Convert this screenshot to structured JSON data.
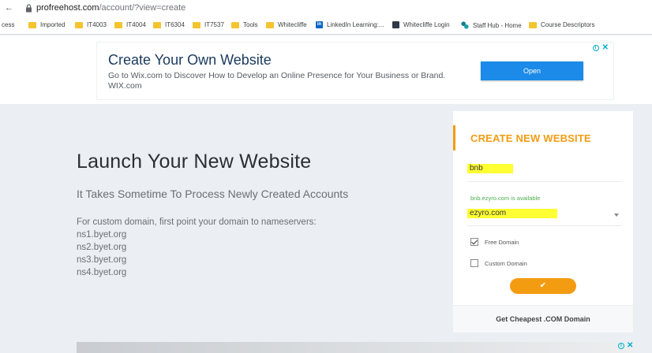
{
  "browser": {
    "back": "←",
    "url_host": "profreehost.com",
    "url_path": "/account/?view=create"
  },
  "bookmarks": [
    {
      "label": "cess",
      "icon": "none"
    },
    {
      "label": "Imported",
      "icon": "folder"
    },
    {
      "label": "IT4003",
      "icon": "folder"
    },
    {
      "label": "IT4004",
      "icon": "folder"
    },
    {
      "label": "IT6304",
      "icon": "folder"
    },
    {
      "label": "IT7537",
      "icon": "folder"
    },
    {
      "label": "Tools",
      "icon": "folder"
    },
    {
      "label": "Whitecliffe",
      "icon": "folder"
    },
    {
      "label": "LinkedIn Learning:...",
      "icon": "linkedin"
    },
    {
      "label": "Whitecliffe Login",
      "icon": "whitecliffe"
    },
    {
      "label": "Staff Hub - Home",
      "icon": "staffhub"
    },
    {
      "label": "Course Descriptors",
      "icon": "folder"
    }
  ],
  "ad": {
    "title": "Create Your Own Website",
    "description": "Go to Wix.com to Discover How to Develop an Online Presence for Your Business or Brand. WIX.com",
    "button": "Open",
    "info_icon": "i",
    "close_icon": "✕"
  },
  "main": {
    "headline": "Launch Your New Website",
    "subheadline": "It Takes Sometime To Process Newly Created Accounts",
    "instructions": "For custom domain, first point your domain to nameservers:",
    "nameservers": [
      "ns1.byet.org",
      "ns2.byet.org",
      "ns3.byet.org",
      "ns4.byet.org"
    ]
  },
  "card": {
    "title": "CREATE NEW WEBSITE",
    "subdomain_value": "bnb",
    "availability": "bnb.ezyro.com is available",
    "domain_value": "ezyro.com",
    "options": [
      {
        "label": "Free Domain",
        "checked": true
      },
      {
        "label": "Custom Domain",
        "checked": false
      }
    ],
    "submit_icon": "✔",
    "footer_link": "Get Cheapest .COM Domain"
  },
  "colors": {
    "accent": "#f39c12",
    "highlight": "#ffff33",
    "available": "#4caf50",
    "ad_button": "#1b8ae8",
    "background": "#ebeef2"
  }
}
